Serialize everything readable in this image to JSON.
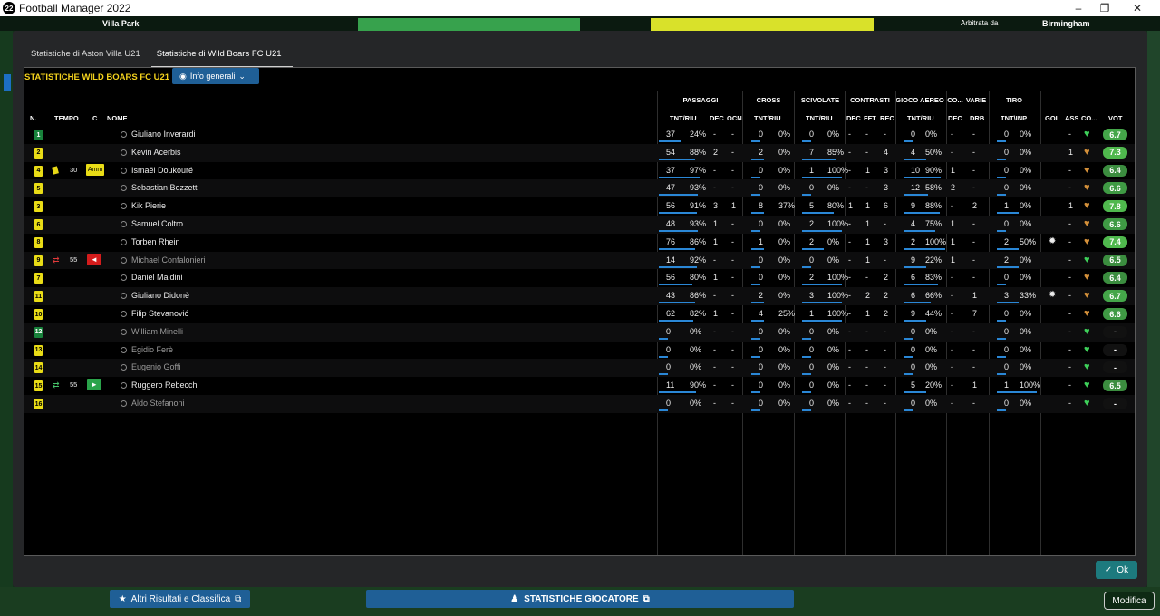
{
  "window": {
    "title": "Football Manager 2022",
    "app_icon": "22"
  },
  "background": {
    "stadium": "Villa Park",
    "referee_label": "Arbitrata da",
    "city": "Birmingham"
  },
  "tabs": [
    {
      "label": "Statistiche di Aston Villa U21"
    },
    {
      "label": "Statistiche di Wild Boars FC U21"
    }
  ],
  "panel": {
    "title": "STATISTICHE WILD BOARS FC U21",
    "info_button": "Info generali"
  },
  "groups": {
    "passaggi": "PASSAGGI",
    "cross": "CROSS",
    "scivolate": "SCIVOLATE",
    "contrasti": "CONTRASTI",
    "gioco_aereo": "GIOCO AEREO",
    "co": "CO...",
    "varie": "VARIE",
    "tiro": "TIRO"
  },
  "columns": {
    "n": "N.",
    "tempo": "TEMPO",
    "c": "C",
    "nome": "NOME",
    "pass_tr": "TNT/RIU",
    "pass_dec": "DEC",
    "pass_ocn": "OCN",
    "cross_tr": "TNT/RIU",
    "sciv_tr": "TNT/RIU",
    "con_dec": "DEC",
    "con_fft": "FFT",
    "con_rec": "REC",
    "aereo_tr": "TNT/RIU",
    "co_dec": "DEC",
    "drb": "DRB",
    "tiro_tr": "TNT\\INP",
    "gol": "GOL",
    "ass": "ASS",
    "co": "CO...",
    "vot": "VOT"
  },
  "players": [
    {
      "n": "1",
      "color": "g",
      "time": "",
      "card": "",
      "name": "Giuliano Inverardi",
      "sub": false,
      "p": [
        "37",
        "24%"
      ],
      "pd": "-",
      "po": "-",
      "c": [
        "0",
        "0%"
      ],
      "s": [
        "0",
        "0%"
      ],
      "cd": "-",
      "cf": "-",
      "cr": "-",
      "a": [
        "0",
        "0%"
      ],
      "ad": "-",
      "drb": "-",
      "t": [
        "0",
        "0%"
      ],
      "gol": "",
      "ass": "-",
      "heart": "green",
      "vot": "6.7"
    },
    {
      "n": "2",
      "color": "y",
      "time": "",
      "card": "",
      "name": "Kevin Acerbis",
      "sub": false,
      "p": [
        "54",
        "88%"
      ],
      "pd": "2",
      "po": "-",
      "c": [
        "2",
        "0%"
      ],
      "s": [
        "7",
        "85%"
      ],
      "cd": "-",
      "cf": "-",
      "cr": "4",
      "a": [
        "4",
        "50%"
      ],
      "ad": "-",
      "drb": "-",
      "t": [
        "0",
        "0%"
      ],
      "gol": "",
      "ass": "1",
      "heart": "orange",
      "vot": "7.3"
    },
    {
      "n": "4",
      "color": "y",
      "time": "30",
      "card": "Amm",
      "name": "Ismaël Doukouré",
      "sub": false,
      "p": [
        "37",
        "97%"
      ],
      "pd": "-",
      "po": "-",
      "c": [
        "0",
        "0%"
      ],
      "s": [
        "1",
        "100%"
      ],
      "cd": "-",
      "cf": "1",
      "cr": "3",
      "a": [
        "10",
        "90%"
      ],
      "ad": "1",
      "drb": "-",
      "t": [
        "0",
        "0%"
      ],
      "gol": "",
      "ass": "-",
      "heart": "orange",
      "vot": "6.4"
    },
    {
      "n": "5",
      "color": "y",
      "time": "",
      "card": "",
      "name": "Sebastian Bozzetti",
      "sub": false,
      "p": [
        "47",
        "93%"
      ],
      "pd": "-",
      "po": "-",
      "c": [
        "0",
        "0%"
      ],
      "s": [
        "0",
        "0%"
      ],
      "cd": "-",
      "cf": "-",
      "cr": "3",
      "a": [
        "12",
        "58%"
      ],
      "ad": "2",
      "drb": "-",
      "t": [
        "0",
        "0%"
      ],
      "gol": "",
      "ass": "-",
      "heart": "orange",
      "vot": "6.6"
    },
    {
      "n": "3",
      "color": "y",
      "time": "",
      "card": "",
      "name": "Kik Pierie",
      "sub": false,
      "p": [
        "56",
        "91%"
      ],
      "pd": "3",
      "po": "1",
      "c": [
        "8",
        "37%"
      ],
      "s": [
        "5",
        "80%"
      ],
      "cd": "1",
      "cf": "1",
      "cr": "6",
      "a": [
        "9",
        "88%"
      ],
      "ad": "-",
      "drb": "2",
      "t": [
        "1",
        "0%"
      ],
      "gol": "",
      "ass": "1",
      "heart": "orange",
      "vot": "7.8"
    },
    {
      "n": "6",
      "color": "y",
      "time": "",
      "card": "",
      "name": "Samuel Coltro",
      "sub": false,
      "p": [
        "48",
        "93%"
      ],
      "pd": "1",
      "po": "-",
      "c": [
        "0",
        "0%"
      ],
      "s": [
        "2",
        "100%"
      ],
      "cd": "-",
      "cf": "1",
      "cr": "-",
      "a": [
        "4",
        "75%"
      ],
      "ad": "1",
      "drb": "-",
      "t": [
        "0",
        "0%"
      ],
      "gol": "",
      "ass": "-",
      "heart": "orange",
      "vot": "6.6"
    },
    {
      "n": "8",
      "color": "y",
      "time": "",
      "card": "",
      "name": "Torben Rhein",
      "sub": false,
      "p": [
        "76",
        "86%"
      ],
      "pd": "1",
      "po": "-",
      "c": [
        "1",
        "0%"
      ],
      "s": [
        "2",
        "0%"
      ],
      "cd": "-",
      "cf": "1",
      "cr": "3",
      "a": [
        "2",
        "100%"
      ],
      "ad": "1",
      "drb": "-",
      "t": [
        "2",
        "50%"
      ],
      "gol": "ball",
      "ass": "-",
      "heart": "orange",
      "vot": "7.4"
    },
    {
      "n": "9",
      "color": "y",
      "time": "55",
      "card": "out",
      "name": "Michael Confalonieri",
      "sub": true,
      "p": [
        "14",
        "92%"
      ],
      "pd": "-",
      "po": "-",
      "c": [
        "0",
        "0%"
      ],
      "s": [
        "0",
        "0%"
      ],
      "cd": "-",
      "cf": "1",
      "cr": "-",
      "a": [
        "9",
        "22%"
      ],
      "ad": "1",
      "drb": "-",
      "t": [
        "2",
        "0%"
      ],
      "gol": "",
      "ass": "-",
      "heart": "green",
      "vot": "6.5"
    },
    {
      "n": "7",
      "color": "y",
      "time": "",
      "card": "",
      "name": "Daniel Maldini",
      "sub": false,
      "p": [
        "56",
        "80%"
      ],
      "pd": "1",
      "po": "-",
      "c": [
        "0",
        "0%"
      ],
      "s": [
        "2",
        "100%"
      ],
      "cd": "-",
      "cf": "-",
      "cr": "2",
      "a": [
        "6",
        "83%"
      ],
      "ad": "-",
      "drb": "-",
      "t": [
        "0",
        "0%"
      ],
      "gol": "",
      "ass": "-",
      "heart": "orange",
      "vot": "6.4"
    },
    {
      "n": "11",
      "color": "y",
      "time": "",
      "card": "",
      "name": "Giuliano Didonè",
      "sub": false,
      "p": [
        "43",
        "86%"
      ],
      "pd": "-",
      "po": "-",
      "c": [
        "2",
        "0%"
      ],
      "s": [
        "3",
        "100%"
      ],
      "cd": "-",
      "cf": "2",
      "cr": "2",
      "a": [
        "6",
        "66%"
      ],
      "ad": "-",
      "drb": "1",
      "t": [
        "3",
        "33%"
      ],
      "gol": "ball",
      "ass": "-",
      "heart": "orange",
      "vot": "6.7"
    },
    {
      "n": "10",
      "color": "y",
      "time": "",
      "card": "",
      "name": "Filip Stevanović",
      "sub": false,
      "p": [
        "62",
        "82%"
      ],
      "pd": "1",
      "po": "-",
      "c": [
        "4",
        "25%"
      ],
      "s": [
        "1",
        "100%"
      ],
      "cd": "-",
      "cf": "1",
      "cr": "2",
      "a": [
        "9",
        "44%"
      ],
      "ad": "-",
      "drb": "7",
      "t": [
        "0",
        "0%"
      ],
      "gol": "",
      "ass": "-",
      "heart": "orange",
      "vot": "6.6"
    },
    {
      "n": "12",
      "color": "g",
      "time": "",
      "card": "",
      "name": "William Minelli",
      "sub": true,
      "p": [
        "0",
        "0%"
      ],
      "pd": "-",
      "po": "-",
      "c": [
        "0",
        "0%"
      ],
      "s": [
        "0",
        "0%"
      ],
      "cd": "-",
      "cf": "-",
      "cr": "-",
      "a": [
        "0",
        "0%"
      ],
      "ad": "-",
      "drb": "-",
      "t": [
        "0",
        "0%"
      ],
      "gol": "",
      "ass": "-",
      "heart": "green",
      "vot": "-"
    },
    {
      "n": "13",
      "color": "y",
      "time": "",
      "card": "",
      "name": "Egidio Ferè",
      "sub": true,
      "p": [
        "0",
        "0%"
      ],
      "pd": "-",
      "po": "-",
      "c": [
        "0",
        "0%"
      ],
      "s": [
        "0",
        "0%"
      ],
      "cd": "-",
      "cf": "-",
      "cr": "-",
      "a": [
        "0",
        "0%"
      ],
      "ad": "-",
      "drb": "-",
      "t": [
        "0",
        "0%"
      ],
      "gol": "",
      "ass": "-",
      "heart": "green",
      "vot": "-"
    },
    {
      "n": "14",
      "color": "y",
      "time": "",
      "card": "",
      "name": "Eugenio Goffi",
      "sub": true,
      "p": [
        "0",
        "0%"
      ],
      "pd": "-",
      "po": "-",
      "c": [
        "0",
        "0%"
      ],
      "s": [
        "0",
        "0%"
      ],
      "cd": "-",
      "cf": "-",
      "cr": "-",
      "a": [
        "0",
        "0%"
      ],
      "ad": "-",
      "drb": "-",
      "t": [
        "0",
        "0%"
      ],
      "gol": "",
      "ass": "-",
      "heart": "green",
      "vot": "-"
    },
    {
      "n": "15",
      "color": "y",
      "time": "55",
      "card": "in",
      "name": "Ruggero Rebecchi",
      "sub": false,
      "p": [
        "11",
        "90%"
      ],
      "pd": "-",
      "po": "-",
      "c": [
        "0",
        "0%"
      ],
      "s": [
        "0",
        "0%"
      ],
      "cd": "-",
      "cf": "-",
      "cr": "-",
      "a": [
        "5",
        "20%"
      ],
      "ad": "-",
      "drb": "1",
      "t": [
        "1",
        "100%"
      ],
      "gol": "",
      "ass": "-",
      "heart": "green",
      "vot": "6.5"
    },
    {
      "n": "16",
      "color": "y",
      "time": "",
      "card": "",
      "name": "Aldo Stefanoni",
      "sub": true,
      "p": [
        "0",
        "0%"
      ],
      "pd": "-",
      "po": "-",
      "c": [
        "0",
        "0%"
      ],
      "s": [
        "0",
        "0%"
      ],
      "cd": "-",
      "cf": "-",
      "cr": "-",
      "a": [
        "0",
        "0%"
      ],
      "ad": "-",
      "drb": "-",
      "t": [
        "0",
        "0%"
      ],
      "gol": "",
      "ass": "-",
      "heart": "green",
      "vot": "-"
    }
  ],
  "buttons": {
    "ok": "Ok",
    "results": "Altri Risultati e Classifica",
    "player_stats": "STATISTICHE GIOCATORE",
    "modifica": "Modifica"
  },
  "colors": {
    "accent_blue": "#1f5f96",
    "title_yellow": "#f4d21d",
    "rating_green": "#44a649",
    "ok_teal": "#1d7a7e"
  }
}
